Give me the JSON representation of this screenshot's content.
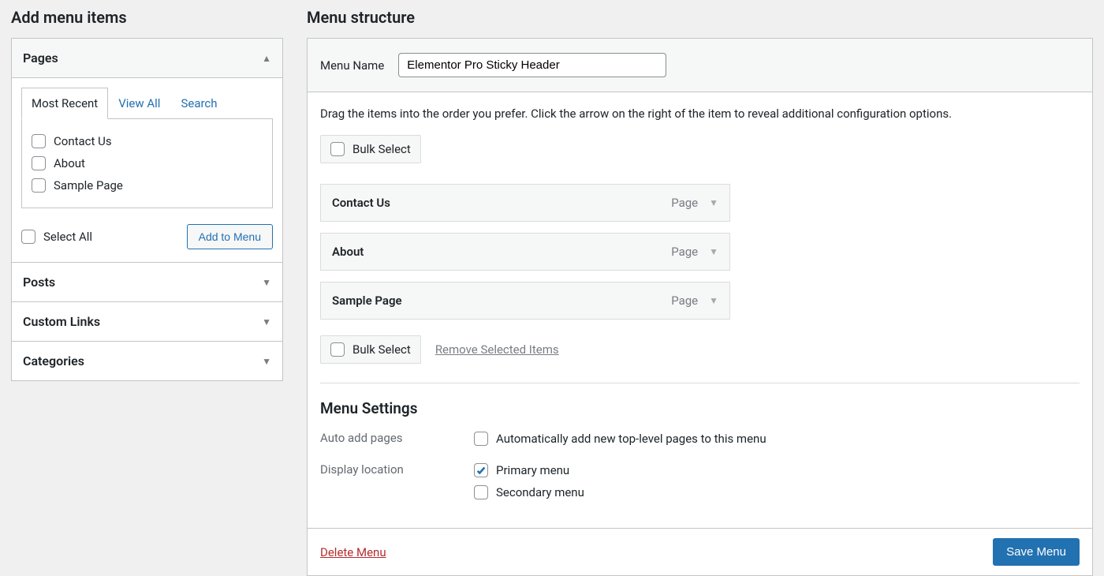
{
  "left": {
    "title": "Add menu items",
    "sections": [
      {
        "label": "Pages",
        "expanded": true
      },
      {
        "label": "Posts",
        "expanded": false
      },
      {
        "label": "Custom Links",
        "expanded": false
      },
      {
        "label": "Categories",
        "expanded": false
      }
    ],
    "pages_panel": {
      "tabs": [
        "Most Recent",
        "View All",
        "Search"
      ],
      "active_tab": "Most Recent",
      "items": [
        {
          "label": "Contact Us"
        },
        {
          "label": "About"
        },
        {
          "label": "Sample Page"
        }
      ],
      "select_all": "Select All",
      "add_button": "Add to Menu"
    }
  },
  "right": {
    "title": "Menu structure",
    "menu_name_label": "Menu Name",
    "menu_name_value": "Elementor Pro Sticky Header",
    "instructions": "Drag the items into the order you prefer. Click the arrow on the right of the item to reveal additional configuration options.",
    "bulk_select": "Bulk Select",
    "remove_selected": "Remove Selected Items",
    "menu_items": [
      {
        "title": "Contact Us",
        "type": "Page"
      },
      {
        "title": "About",
        "type": "Page"
      },
      {
        "title": "Sample Page",
        "type": "Page"
      }
    ],
    "settings": {
      "title": "Menu Settings",
      "auto_add_label": "Auto add pages",
      "auto_add_option": "Automatically add new top-level pages to this menu",
      "display_loc_label": "Display location",
      "locations": [
        {
          "label": "Primary menu",
          "checked": true
        },
        {
          "label": "Secondary menu",
          "checked": false
        }
      ]
    },
    "delete_menu": "Delete Menu",
    "save_menu": "Save Menu"
  }
}
